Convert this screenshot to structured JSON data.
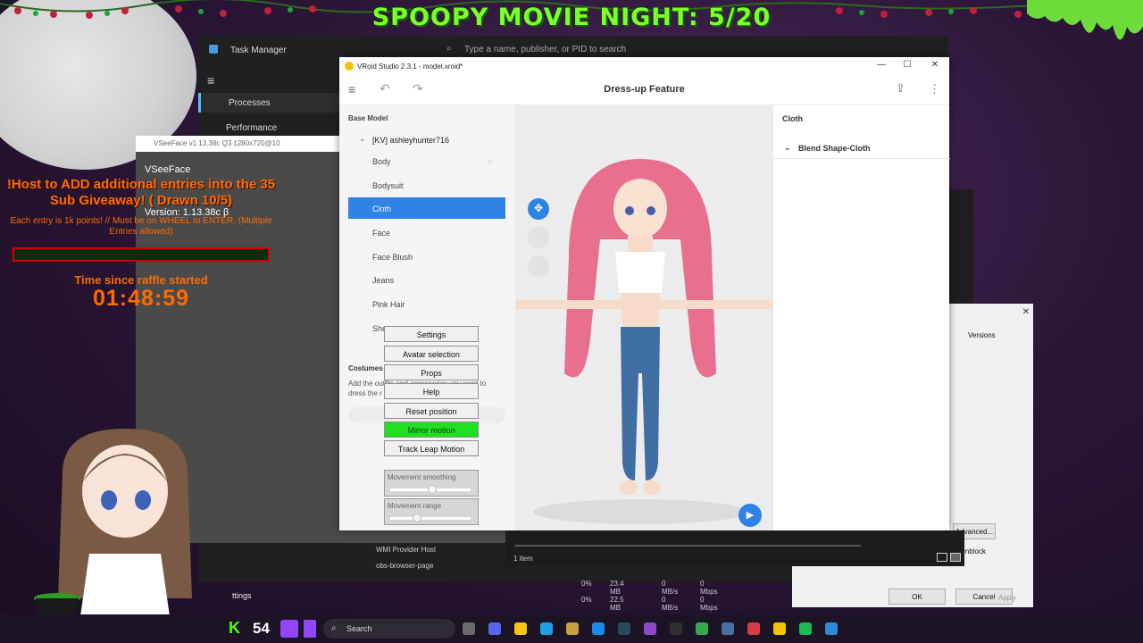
{
  "banner": "SPOOPY MOVIE NIGHT: 5/20",
  "task_manager": {
    "title": "Task Manager",
    "search_placeholder": "Type a name, publisher, or PID to search",
    "nav": [
      "Processes",
      "Performance"
    ],
    "rows": [
      {
        "name": "WMI Provider Host",
        "cpu": "0%",
        "mem": "23.4 MB",
        "disk": "0 MB/s",
        "net": "0 Mbps"
      },
      {
        "name": "obs-browser-page",
        "cpu": "0%",
        "mem": "22.5 MB",
        "disk": "0 MB/s",
        "net": "0 Mbps"
      }
    ]
  },
  "vseeface": {
    "title": "VSeeFace v1.13.38c Q3 1280x720@10",
    "name": "VSeeFace",
    "version": "Version: 1.13.38c β",
    "menu": [
      "Settings",
      "Avatar selection",
      "Props",
      "Help",
      "Reset position",
      "Mirror motion",
      "Track Leap Motion"
    ],
    "sliders": [
      {
        "label": "Movement smoothing",
        "value": 0.5
      },
      {
        "label": "Movement range",
        "value": 0.35
      }
    ]
  },
  "giveaway": {
    "headline": "!Host to ADD additional entries into the 35 Sub Giveaway! ( Drawn 10/5)",
    "sub": "Each entry is 1k points! // Must be on WHEEL to ENTER. (Multiple Entries allowed)",
    "since_label": "Time since raffle started",
    "timer": "01:48:59"
  },
  "vroid": {
    "title": "VRoid Studio 2.3.1 - model.xroid*",
    "heading": "Dress-up Feature",
    "base_model_label": "Base Model",
    "group": "[KV] ashleyhunter716",
    "items": [
      "Body",
      "Bodysuit",
      "Cloth",
      "Face",
      "Face Blush",
      "Jeans",
      "Pink Hair",
      "She"
    ],
    "selected_index": 2,
    "costumes_label": "Costumes",
    "costumes_desc": "Add the outfits and accessories you want to dress the r",
    "right_title": "Cloth",
    "blend_shape": "Blend Shape-Cloth"
  },
  "explorer": {
    "count": "1 item"
  },
  "properties": {
    "tab": "Versions",
    "ok": "OK",
    "cancel": "Cancel",
    "apply": "Apply",
    "advanced": "Advanced...",
    "unblock": "Unblock"
  },
  "taskbar": {
    "k_count": "54",
    "search": "Search",
    "settings_hint": "ttings"
  },
  "colors": {
    "accent": "#2f82e6",
    "banner_green": "#7cff2e",
    "overlay_orange": "#ff6a00",
    "mirror_green": "#1ee01e"
  }
}
